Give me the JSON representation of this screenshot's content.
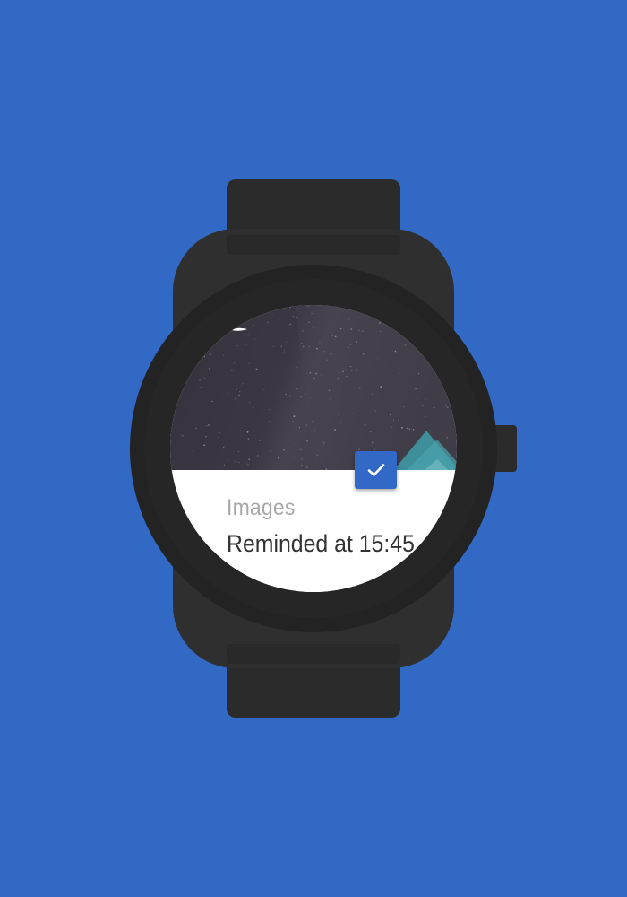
{
  "background_color": "#3169c4",
  "watch": {
    "case_color": "#2f2f2f",
    "band_color": "#2b2b2b"
  },
  "notification": {
    "app_name": "Images",
    "message": "Reminded at 15:45",
    "action_icon": "check-icon",
    "accent_color": "#3269c6"
  }
}
